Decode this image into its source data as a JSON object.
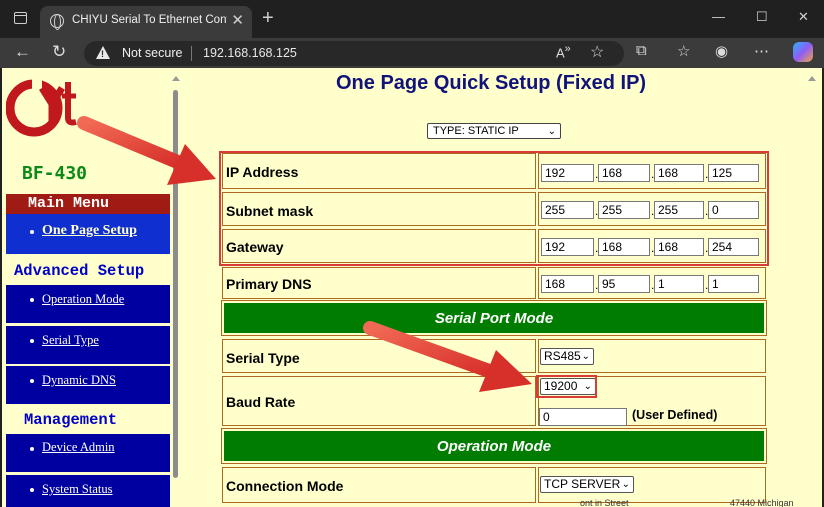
{
  "browser": {
    "tab_title": "CHIYU Serial To Ethernet Converte",
    "security_label": "Not secure",
    "url": "192.168.168.125"
  },
  "sidebar": {
    "model": "BF-430",
    "main_menu": "Main Menu",
    "one_page_setup": "One Page Setup",
    "advanced_setup": "Advanced Setup",
    "advanced_items": [
      "Operation Mode",
      "Serial Type",
      "Dynamic DNS"
    ],
    "management": "Management",
    "management_items": [
      "Device Admin",
      "System Status"
    ]
  },
  "main": {
    "title": "One Page Quick Setup (Fixed IP)",
    "type_select": "TYPE: STATIC IP",
    "rows": {
      "ip_label": "IP Address",
      "ip": [
        "192",
        "168",
        "168",
        "125"
      ],
      "mask_label": "Subnet mask",
      "mask": [
        "255",
        "255",
        "255",
        "0"
      ],
      "gw_label": "Gateway",
      "gw": [
        "192",
        "168",
        "168",
        "254"
      ],
      "dns_label": "Primary DNS",
      "dns": [
        "168",
        "95",
        "1",
        "1"
      ]
    },
    "serial_band": "Serial Port Mode",
    "serial_type_label": "Serial Type",
    "serial_type": "RS485",
    "baud_label": "Baud Rate",
    "baud": "19200",
    "baud_custom": "0",
    "user_defined": "(User Defined)",
    "operation_band": "Operation Mode",
    "connection_label": "Connection Mode",
    "connection": "TCP SERVER"
  },
  "footer_fragments": [
    "ont in Street",
    "47440 Michigan"
  ],
  "colors": {
    "page_bg": "#ffffcc",
    "band_green": "#007c00",
    "nav_blue": "#0000a0",
    "menu_red": "#a01b14",
    "highlight_red": "#d93a3a",
    "title_navy": "#10137a"
  },
  "icons": [
    "window-menu-icon",
    "globe-icon",
    "close-icon",
    "new-tab-icon",
    "back-icon",
    "reload-icon",
    "warning-icon",
    "read-aloud-icon",
    "favorite-star-icon",
    "extensions-icon",
    "favorites-list-icon",
    "profile-icon",
    "more-icon",
    "copilot-icon"
  ]
}
